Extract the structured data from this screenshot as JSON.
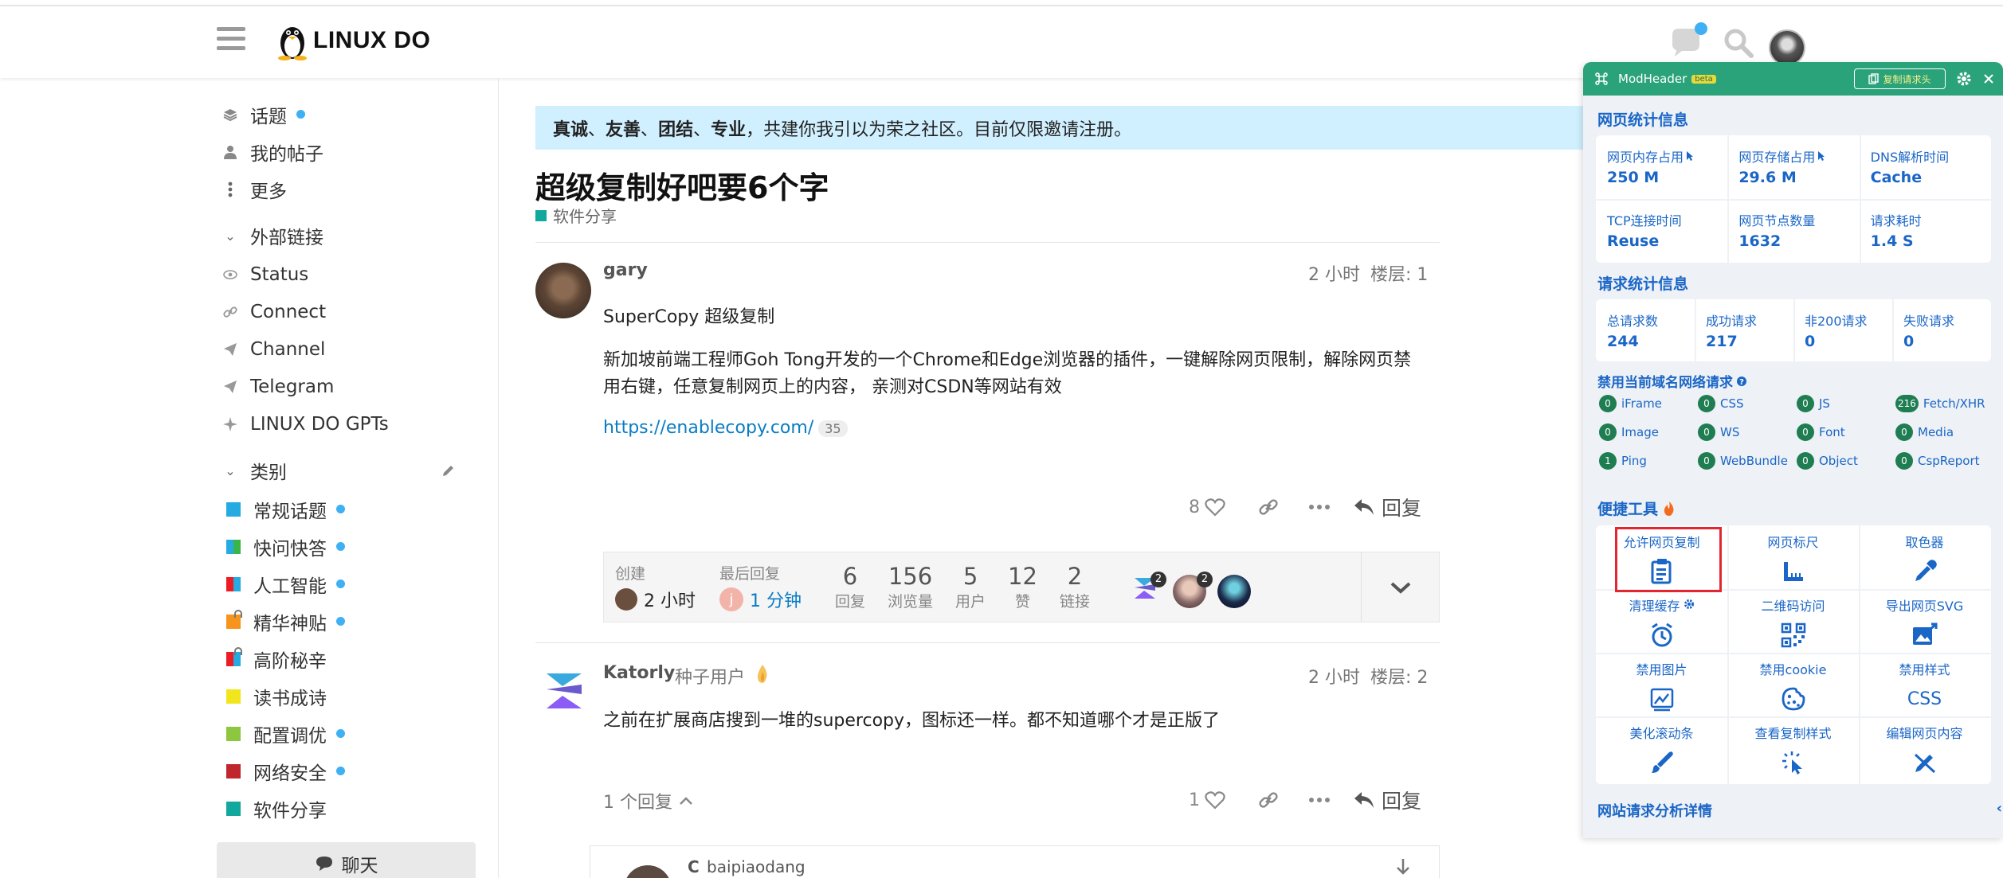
{
  "header": {
    "logo_text": "LINUX DO"
  },
  "sidebar": {
    "top_items": [
      {
        "label": "话题",
        "icon": "layers-icon",
        "dot": true
      },
      {
        "label": "我的帖子",
        "icon": "user-icon"
      },
      {
        "label": "更多",
        "icon": "ellipsis-vertical-icon"
      }
    ],
    "external_header": "外部链接",
    "external_items": [
      {
        "label": "Status",
        "icon": "eye-icon"
      },
      {
        "label": "Connect",
        "icon": "link-icon"
      },
      {
        "label": "Channel",
        "icon": "send-icon"
      },
      {
        "label": "Telegram",
        "icon": "send-icon"
      },
      {
        "label": "LINUX DO GPTs",
        "icon": "sparkle-icon"
      }
    ],
    "categories_header": "类别",
    "categories": [
      {
        "label": "常规话题",
        "colors": [
          "#25AAE2"
        ],
        "dot": true
      },
      {
        "label": "快问快答",
        "colors": [
          "#25AAE2",
          "#3AB54A"
        ],
        "dot": true
      },
      {
        "label": "人工智能",
        "colors": [
          "#ED1C24",
          "#25AAE2"
        ],
        "dot": true
      },
      {
        "label": "精华神贴",
        "colors": [
          "#F7941D"
        ],
        "dot": true,
        "lock": true
      },
      {
        "label": "高阶秘辛",
        "colors": [
          "#ED1C24",
          "#25AAE2"
        ],
        "dot": false,
        "lock": true
      },
      {
        "label": "读书成诗",
        "colors": [
          "#F1E61D"
        ],
        "dot": false
      },
      {
        "label": "配置调优",
        "colors": [
          "#8DC63F"
        ],
        "dot": true
      },
      {
        "label": "网络安全",
        "colors": [
          "#C0272D"
        ],
        "dot": true
      },
      {
        "label": "软件分享",
        "colors": [
          "#12A89D"
        ],
        "dot": false
      }
    ],
    "chat_label": "聊天"
  },
  "banner": {
    "w1": "真诚",
    "s1": "、",
    "w2": "友善",
    "s2": "、",
    "w3": "团结",
    "s3": "、",
    "w4": "专业",
    "rest": "，共建你我引以为荣之社区。目前仅限邀请注册。"
  },
  "topic": {
    "title": "超级复制好吧要6个字",
    "category": "软件分享"
  },
  "post1": {
    "username": "gary",
    "time": "2 小时",
    "floor": "楼层: 1",
    "para1": "SuperCopy 超级复制",
    "para2_line1": "新加坡前端工程师Goh Tong开发的一个Chrome和Edge浏览器的插件，一键解除网页限制，解除网页禁",
    "para2_line2": "用右键，任意复制网页上的内容， 亲测对CSDN等网站有效",
    "link": "https://enablecopy.com/",
    "link_clicks": "35",
    "likes": "8",
    "reply_label": "回复"
  },
  "stats": {
    "created_label": "创建",
    "created_value": "2 小时",
    "last_reply_label": "最后回复",
    "last_reply_value": "1 分钟",
    "last_reply_initial": "j",
    "items": [
      {
        "n": "6",
        "l": "回复"
      },
      {
        "n": "156",
        "l": "浏览量"
      },
      {
        "n": "5",
        "l": "用户"
      },
      {
        "n": "12",
        "l": "赞"
      },
      {
        "n": "2",
        "l": "链接"
      }
    ],
    "participant_counts": [
      "2",
      "2"
    ]
  },
  "post2": {
    "username": "Katorly",
    "title": "种子用户",
    "time": "2 小时",
    "floor": "楼层: 2",
    "text": "之前在扩展商店搜到一堆的supercopy，图标还一样。都不知道哪个才是正版了",
    "replies_toggle": "1 个回复",
    "likes": "1",
    "reply_label": "回复"
  },
  "post3": {
    "prefix": "C",
    "username": "baipiaodang"
  },
  "modheader": {
    "title": "ModHeader",
    "beta": "beta",
    "copy_button": "复制请求头",
    "page_stats_title": "网页统计信息",
    "page_stats": [
      {
        "k": "网页内存占用",
        "v": "250 M",
        "cursor": true
      },
      {
        "k": "网页存储占用",
        "v": "29.6 M",
        "cursor": true
      },
      {
        "k": "DNS解析时间",
        "v": "Cache"
      },
      {
        "k": "TCP连接时间",
        "v": "Reuse"
      },
      {
        "k": "网页节点数量",
        "v": "1632"
      },
      {
        "k": "请求耗时",
        "v": "1.4 S"
      }
    ],
    "req_stats_title": "请求统计信息",
    "req_stats": [
      {
        "k": "总请求数",
        "v": "244"
      },
      {
        "k": "成功请求",
        "v": "217"
      },
      {
        "k": "非200请求",
        "v": "0"
      },
      {
        "k": "失败请求",
        "v": "0"
      }
    ],
    "block_title": "禁用当前域名网络请求",
    "block_items": [
      {
        "c": "0",
        "l": "iFrame"
      },
      {
        "c": "0",
        "l": "CSS"
      },
      {
        "c": "0",
        "l": "JS"
      },
      {
        "c": "216",
        "l": "Fetch/XHR"
      },
      {
        "c": "0",
        "l": "Image"
      },
      {
        "c": "0",
        "l": "WS"
      },
      {
        "c": "0",
        "l": "Font"
      },
      {
        "c": "0",
        "l": "Media"
      },
      {
        "c": "1",
        "l": "Ping"
      },
      {
        "c": "0",
        "l": "WebBundle"
      },
      {
        "c": "0",
        "l": "Object"
      },
      {
        "c": "0",
        "l": "CspReport"
      }
    ],
    "tools_title": "便捷工具",
    "tools": [
      {
        "l": "允许网页复制",
        "icon": "clipboard-icon"
      },
      {
        "l": "网页标尺",
        "icon": "ruler-icon"
      },
      {
        "l": "取色器",
        "icon": "eyedropper-icon"
      },
      {
        "l": "清理缓存",
        "icon": "clock-clear-icon",
        "gear": true
      },
      {
        "l": "二维码访问",
        "icon": "qrcode-icon"
      },
      {
        "l": "导出网页SVG",
        "icon": "image-export-icon"
      },
      {
        "l": "禁用图片",
        "icon": "image-off-icon"
      },
      {
        "l": "禁用cookie",
        "icon": "cookie-icon"
      },
      {
        "l": "禁用样式",
        "icon": "css-icon",
        "glyph": "CSS"
      },
      {
        "l": "美化滚动条",
        "icon": "brush-icon"
      },
      {
        "l": "查看复制样式",
        "icon": "pointer-click-icon"
      },
      {
        "l": "编辑网页内容",
        "icon": "pencil-cross-icon"
      }
    ],
    "footer": "网站请求分析详情"
  }
}
